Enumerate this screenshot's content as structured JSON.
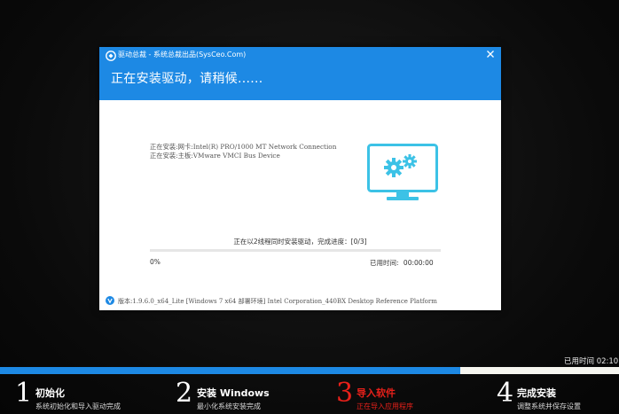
{
  "window_title": "驱动总裁 - 系统总裁出品(SysCeo.Com)",
  "heading": "正在安装驱动，请稍候......",
  "status_lines": [
    "正在安装:网卡:Intel(R) PRO/1000 MT Network Connection",
    "正在安装:主板:VMware VMCI Bus Device"
  ],
  "progress": {
    "text": "正在以2线程同时安装驱动，完成进度：[0/3]",
    "percent_label": "0%",
    "percent": 0,
    "elapsed_label": "已用时间:",
    "elapsed_value": "00:00:00"
  },
  "version_text": "版本:1.9.6.0_x64_Lite [Windows 7 x64 部署环境] Intel Corporation_440BX Desktop Reference Platform",
  "outer": {
    "elapsed": "已用时间 02:10",
    "main_progress": 0.743
  },
  "steps": [
    {
      "num": "1",
      "title": "初始化",
      "sub": "系统初始化和导入驱动完成",
      "active": false
    },
    {
      "num": "2",
      "title": "安装 Windows",
      "sub": "最小化系统安装完成",
      "active": false
    },
    {
      "num": "3",
      "title": "导入软件",
      "sub": "正在导入应用程序",
      "active": true
    },
    {
      "num": "4",
      "title": "完成安装",
      "sub": "调整系统并保存设置",
      "active": false
    }
  ],
  "icons": {
    "logo": "driver-logo-icon",
    "close": "close-icon",
    "monitor": "monitor-gears-icon",
    "version": "version-v-icon"
  },
  "colors": {
    "accent": "#1d89e4",
    "active_step": "#e8201a",
    "icon_cyan": "#3cc2e6"
  }
}
